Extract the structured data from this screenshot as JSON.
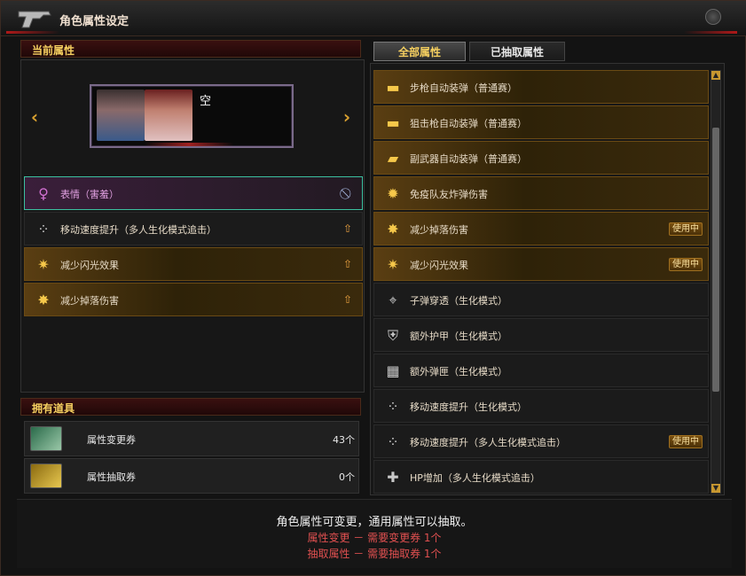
{
  "window": {
    "title": "角色属性设定",
    "colors": {
      "accent": "#f6d060",
      "selected_border": "#3cc0a0",
      "warning_red": "#e05050"
    }
  },
  "current": {
    "header": "当前属性",
    "character_name": "空",
    "prev_icon": "chevron-left-icon",
    "next_icon": "chevron-right-icon",
    "attributes": [
      {
        "label": "表情（害羞）",
        "icon": "dance-figure-icon",
        "action_icon": "ban-icon",
        "style": "selected"
      },
      {
        "label": "移动速度提升（多人生化模式追击）",
        "icon": "speed-dots-icon",
        "action_icon": "upgrade-arrow-icon",
        "style": "dark"
      },
      {
        "label": "减少闪光效果",
        "icon": "flash-icon",
        "action_icon": "upgrade-arrow-icon",
        "style": "gold"
      },
      {
        "label": "减少掉落伤害",
        "icon": "fall-damage-icon",
        "action_icon": "upgrade-arrow-icon",
        "style": "gold"
      }
    ]
  },
  "items": {
    "header": "拥有道具",
    "list": [
      {
        "name": "属性变更券",
        "count": "43个",
        "icon": "change-ticket-icon"
      },
      {
        "name": "属性抽取券",
        "count": "0个",
        "icon": "extract-ticket-icon"
      }
    ]
  },
  "tabs": {
    "all": "全部属性",
    "owned": "已抽取属性",
    "active": "all"
  },
  "all_attributes": [
    {
      "label": "步枪自动装弹（普通赛）",
      "icon": "rifle-icon",
      "style": "gold",
      "badge": ""
    },
    {
      "label": "狙击枪自动装弹（普通赛）",
      "icon": "sniper-icon",
      "style": "gold",
      "badge": ""
    },
    {
      "label": "副武器自动装弹（普通赛）",
      "icon": "pistol-icon",
      "style": "gold",
      "badge": ""
    },
    {
      "label": "免疫队友炸弹伤害",
      "icon": "explosion-icon",
      "style": "gold",
      "badge": ""
    },
    {
      "label": "减少掉落伤害",
      "icon": "fall-damage-icon",
      "style": "gold",
      "badge": "使用中"
    },
    {
      "label": "减少闪光效果",
      "icon": "flash-icon",
      "style": "gold",
      "badge": "使用中"
    },
    {
      "label": "子弹穿透（生化模式）",
      "icon": "crosshair-icon",
      "style": "dark",
      "badge": ""
    },
    {
      "label": "额外护甲（生化模式）",
      "icon": "armor-icon",
      "style": "dark",
      "badge": ""
    },
    {
      "label": "额外弹匣（生化模式）",
      "icon": "magazine-icon",
      "style": "dark",
      "badge": ""
    },
    {
      "label": "移动速度提升（生化模式）",
      "icon": "speed-dots-icon",
      "style": "dark",
      "badge": ""
    },
    {
      "label": "移动速度提升（多人生化模式追击）",
      "icon": "speed-dots-icon",
      "style": "dark",
      "badge": "使用中"
    },
    {
      "label": "HP增加（多人生化模式追击）",
      "icon": "hp-icon",
      "style": "dark",
      "badge": ""
    }
  ],
  "footer": {
    "main": "角色属性可变更，通用属性可以抽取。",
    "line1": "属性变更 － 需要变更券 1个",
    "line2": "抽取属性 － 需要抽取券 1个"
  }
}
